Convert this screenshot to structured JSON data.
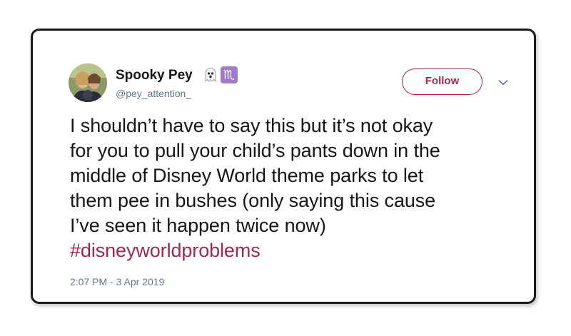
{
  "tweet": {
    "display_name": "Spooky Pey",
    "handle": "@pey_attention_",
    "emoji_icons": [
      "ghost-icon",
      "scorpio-icon"
    ],
    "scorpio_symbol": "♏",
    "follow_label": "Follow",
    "text_lines": [
      "I shouldn’t have to say this but it’s not okay",
      "for you to pull your child’s pants down in the",
      "middle of Disney World theme parks to let",
      "them pee in bushes (only saying this cause",
      "I’ve seen it happen twice now)"
    ],
    "hashtag": "#disneyworldproblems",
    "timestamp": "2:07 PM - 3 Apr 2019"
  },
  "colors": {
    "accent": "#a1294f",
    "text": "#14171a",
    "secondary_text": "#657786",
    "scorpio_badge": "#a07acb"
  }
}
